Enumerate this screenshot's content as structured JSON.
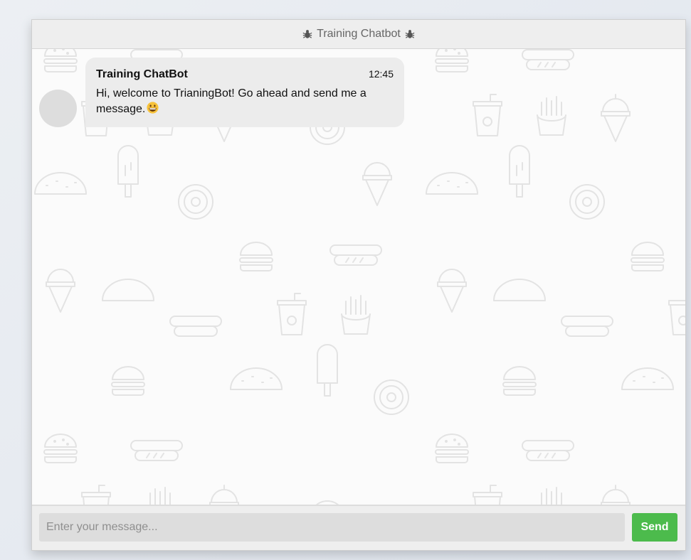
{
  "header": {
    "title": "Training Chatbot",
    "left_icon": "bug-icon",
    "right_icon": "bug-icon"
  },
  "messages": [
    {
      "sender": "Training ChatBot",
      "time": "12:45",
      "text": "Hi, welcome to TrianingBot! Go ahead and send me a message.",
      "emoji": "grinning-face-icon"
    }
  ],
  "composer": {
    "placeholder": "Enter your message...",
    "value": "",
    "send_label": "Send"
  },
  "colors": {
    "send_button": "#4cbb4c",
    "bubble": "#ececec",
    "avatar": "#dddddd",
    "header_bg": "#eeeeee",
    "pattern_stroke": "#e6e6e6"
  }
}
